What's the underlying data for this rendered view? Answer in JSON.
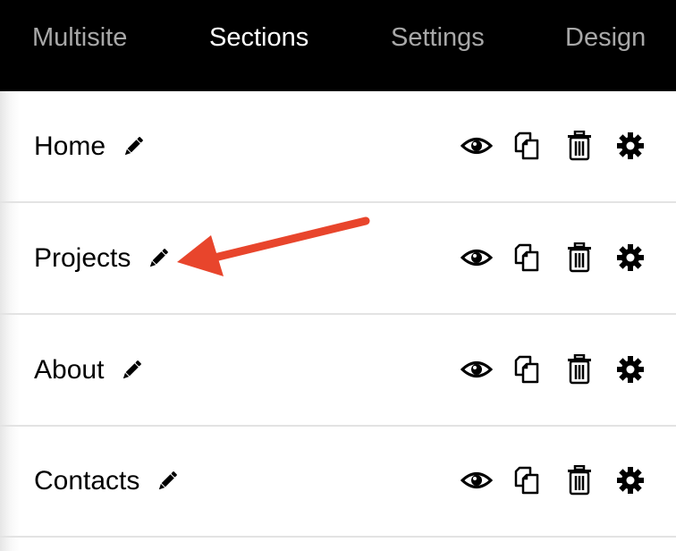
{
  "nav": {
    "tabs": [
      {
        "label": "Multisite",
        "active": false
      },
      {
        "label": "Sections",
        "active": true
      },
      {
        "label": "Settings",
        "active": false
      },
      {
        "label": "Design",
        "active": false
      }
    ]
  },
  "sections": [
    {
      "name": "Home"
    },
    {
      "name": "Projects"
    },
    {
      "name": "About"
    },
    {
      "name": "Contacts"
    }
  ],
  "icons": {
    "edit": "pencil-icon",
    "visibility": "eye-icon",
    "duplicate": "copy-icon",
    "delete": "trash-icon",
    "settings": "gear-icon"
  },
  "annotation": {
    "arrow_color": "#e8452c",
    "points_to": "Projects edit pencil"
  },
  "colors": {
    "topbar_bg": "#000000",
    "tab_inactive": "#a8a8a8",
    "tab_active": "#ffffff",
    "row_divider": "#e3e3e3"
  }
}
